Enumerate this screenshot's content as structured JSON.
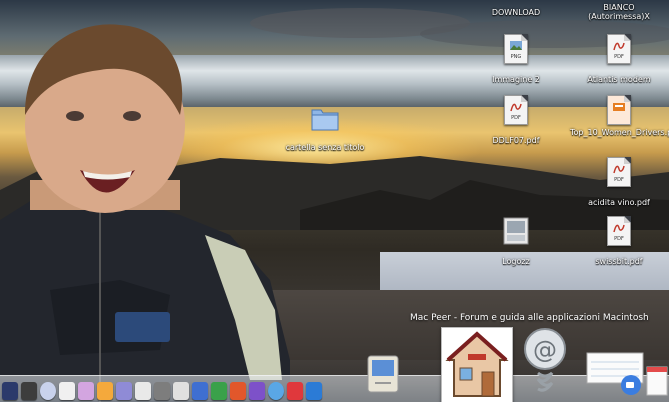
{
  "desktop_icons": [
    {
      "name": "DOWNLOAD",
      "kind": "folder-icon"
    },
    {
      "name": "BIANCO (Autorimessa)X",
      "kind": "folder-icon"
    },
    {
      "name": "Immagine 2",
      "kind": "png-file-icon",
      "tag": "PNG"
    },
    {
      "name": "Atlantis modem",
      "kind": "pdf-file-icon",
      "tag": "PDF"
    },
    {
      "name": "cartella senza titolo",
      "kind": "folder-icon"
    },
    {
      "name": "DDLF07.pdf",
      "kind": "pdf-file-icon",
      "tag": "PDF"
    },
    {
      "name": "Top_10_Women_Drivers.pps",
      "kind": "pps-file-icon"
    },
    {
      "name": "acidita vino.pdf",
      "kind": "pdf-file-icon",
      "tag": "PDF"
    },
    {
      "name": "Logozz",
      "kind": "image-file-icon"
    },
    {
      "name": "swissbit.pdf",
      "kind": "pdf-file-icon",
      "tag": "PDF"
    }
  ],
  "tagline": "Mac Peer - Forum e guida alle applicazioni Macintosh",
  "dock": {
    "items": [
      "imovie-icon",
      "finalcut-icon",
      "itunes-icon",
      "textedit-icon",
      "flower-app-icon",
      "photo-app-icon",
      "grapher-icon",
      "preview-icon",
      "camera-icon",
      "document-icon",
      "word-icon",
      "excel-icon",
      "powerpoint-icon",
      "entourage-icon",
      "messenger-icon",
      "dashboard-icon",
      "zeta-app-icon"
    ],
    "right_items": [
      "classic-mac-icon",
      "mac-peer-icon",
      "mail-icon",
      "notes-icon",
      "ichat-icon",
      "calendar-icon"
    ]
  },
  "colors": {
    "sky_top": "#2c3846",
    "sunset": "#e9c46f",
    "rail": "#dfe5e8"
  }
}
